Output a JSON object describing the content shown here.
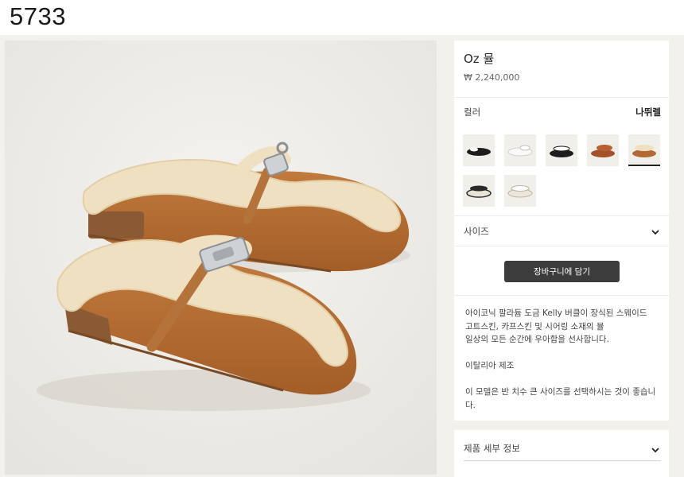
{
  "header": {
    "item_code": "5733"
  },
  "product": {
    "title": "Oz 뮬",
    "price": "₩ 2,240,000",
    "image_icon": "shearling-mule-photo"
  },
  "color": {
    "label": "컬러",
    "selected_value": "나뛰렐",
    "swatches": [
      {
        "name": "black-white",
        "selected": false
      },
      {
        "name": "white",
        "selected": false
      },
      {
        "name": "black-white-lined",
        "selected": false
      },
      {
        "name": "brown-leather",
        "selected": false
      },
      {
        "name": "camel-shearling",
        "selected": true
      },
      {
        "name": "cream-black-trim",
        "selected": false
      },
      {
        "name": "cream-white",
        "selected": false
      }
    ]
  },
  "size": {
    "label": "사이즈",
    "icon": "chevron-down-icon"
  },
  "cart": {
    "button_label": "장바구니에 담기"
  },
  "description": {
    "line1": "아이코닉 팔라듐 도금 Kelly 버클이 장식된 스웨이드",
    "line2": "고트스킨, 카프스킨 및 시어링 소재의 뮬",
    "line3": "일상의 모든 순간에 우아함을 선사합니다.",
    "origin": "이탈리아 제조",
    "size_note": "이 모델은 반 치수 큰 사이즈를 선택하시는 것이 좋습니다."
  },
  "details": {
    "label": "제품 세부 정보",
    "icon": "chevron-down-icon"
  },
  "colors": {
    "background": "#f3f1ec",
    "button": "#3c3c3c",
    "suede": "#b26a34",
    "shearling": "#efe0c2"
  }
}
